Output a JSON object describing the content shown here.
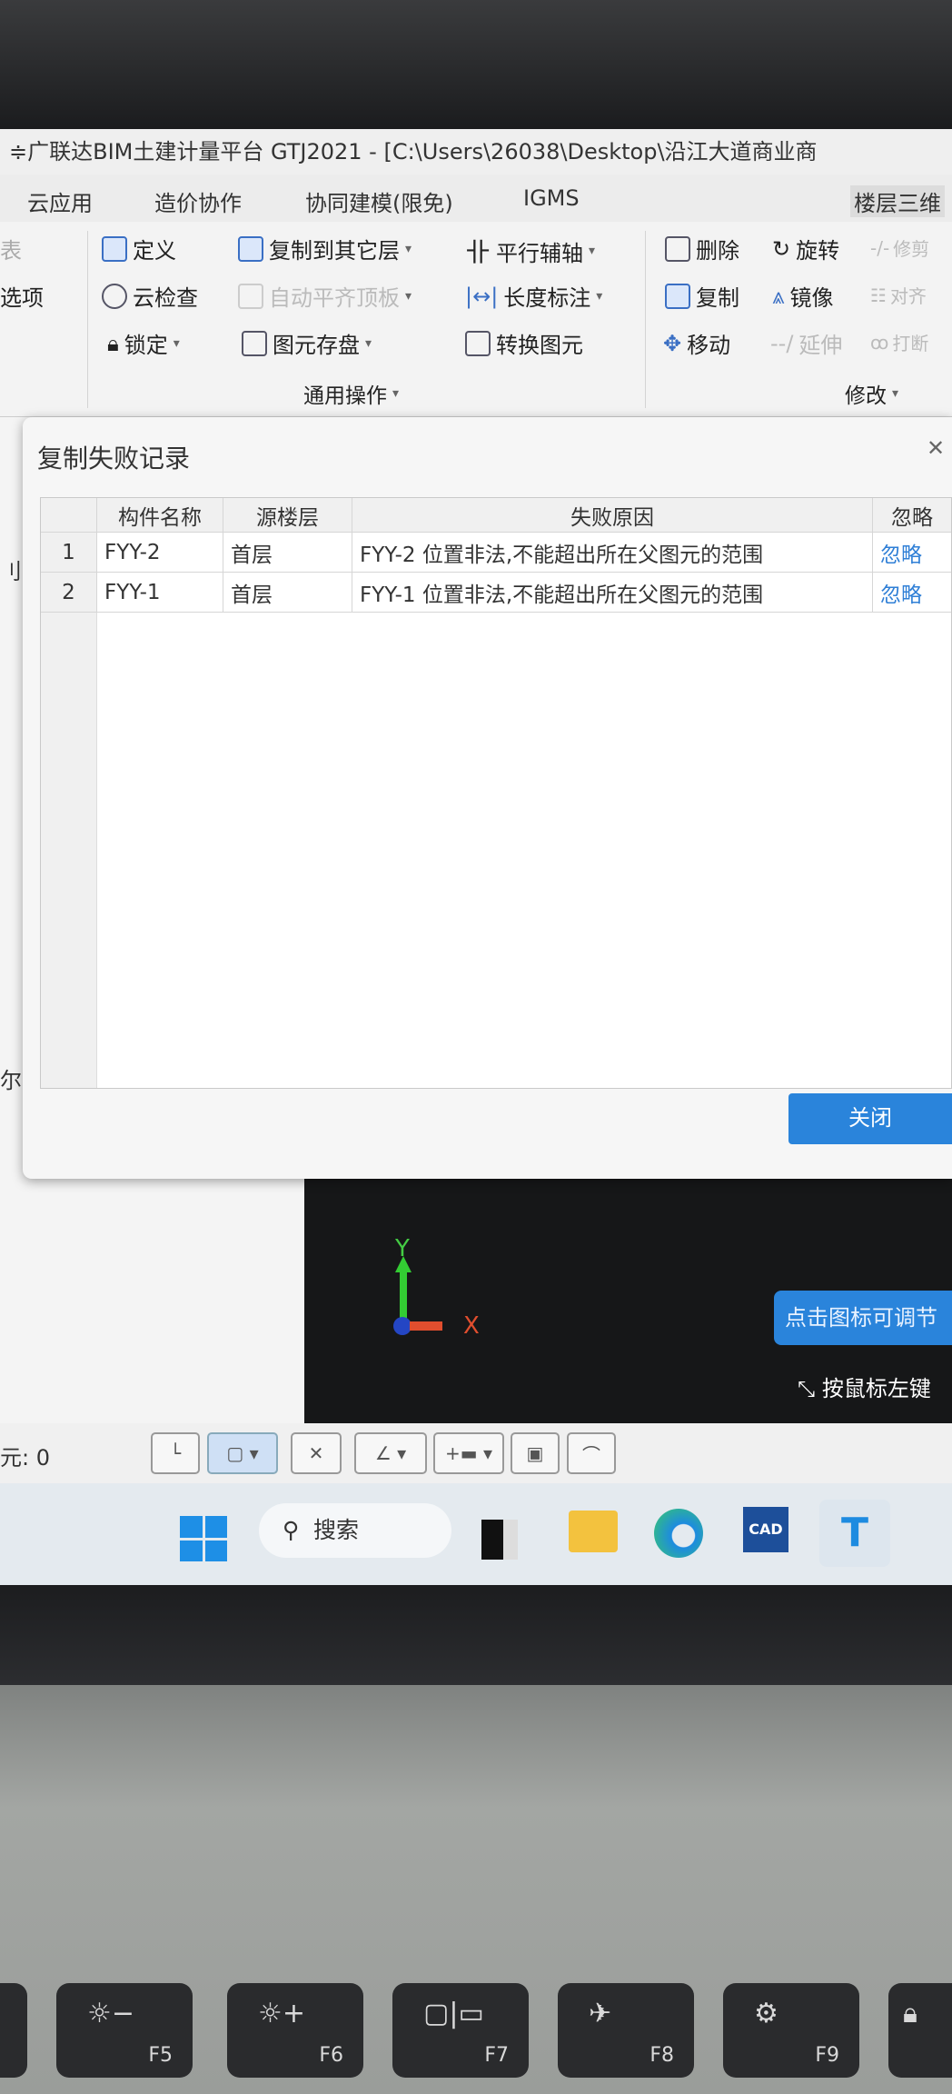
{
  "window": {
    "title": "≑广联达BIM土建计量平台 GTJ2021 - [C:\\Users\\26038\\Desktop\\沿江大道商业商"
  },
  "tabs": [
    "云应用",
    "造价协作",
    "协同建模(限免)",
    "IGMS",
    "楼层三维"
  ],
  "ribbon": {
    "left_partial": [
      "表",
      "选项"
    ],
    "general": {
      "items": [
        "定义",
        "复制到其它层",
        "平行辅轴",
        "云检查",
        "自动平齐顶板",
        "长度标注",
        "锁定",
        "图元存盘",
        "转换图元"
      ],
      "group_label": "通用操作"
    },
    "modify": {
      "items": [
        "删除",
        "旋转",
        "修剪",
        "复制",
        "镜像",
        "对齐",
        "移动",
        "延伸",
        "打断"
      ],
      "group_label": "修改"
    }
  },
  "dialog": {
    "title": "复制失败记录",
    "columns": [
      "",
      "构件名称",
      "源楼层",
      "失败原因",
      "忽略"
    ],
    "rows": [
      {
        "index": "1",
        "name": "FYY-2",
        "floor": "首层",
        "reason": "FYY-2 位置非法,不能超出所在父图元的范围",
        "action": "忽略"
      },
      {
        "index": "2",
        "name": "FYY-1",
        "floor": "首层",
        "reason": "FYY-1 位置非法,不能超出所在父图元的范围",
        "action": "忽略"
      }
    ],
    "close_label": "关闭"
  },
  "left_panel": {
    "partial": [
      "刂",
      "尔"
    ]
  },
  "viewport": {
    "axis_y": "Y",
    "axis_x": "X",
    "tooltip": "点击图标可调节",
    "hint": "按鼠标左键"
  },
  "statusbar": {
    "count": "元: 0"
  },
  "taskbar": {
    "search": "搜索",
    "apps": [
      "windows-start",
      "task-view",
      "file-explorer",
      "edge",
      "cad",
      "gtj"
    ]
  },
  "keyboard": {
    "keys": [
      "F5",
      "F6",
      "F7",
      "F8",
      "F9"
    ]
  },
  "colors": {
    "accent": "#2a84db",
    "link": "#2f7fd6",
    "viewport": "#161718"
  }
}
